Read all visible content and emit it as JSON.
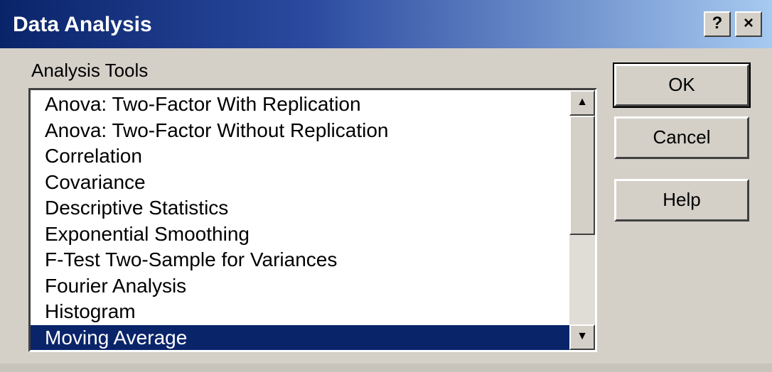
{
  "window": {
    "title": "Data Analysis",
    "help_glyph": "?",
    "close_glyph": "×"
  },
  "analysis_tools_label": "Analysis Tools",
  "list": {
    "items": [
      "Anova: Two-Factor With Replication",
      "Anova: Two-Factor Without Replication",
      "Correlation",
      "Covariance",
      "Descriptive Statistics",
      "Exponential Smoothing",
      "F-Test Two-Sample for Variances",
      "Fourier Analysis",
      "Histogram",
      "Moving Average"
    ],
    "selected_index": 9,
    "scroll_up_glyph": "▲",
    "scroll_down_glyph": "▼"
  },
  "buttons": {
    "ok": "OK",
    "cancel": "Cancel",
    "help": "Help"
  },
  "colors": {
    "selection": "#0a246a",
    "titlebar_start": "#0a246a",
    "titlebar_end": "#a6caf0",
    "face": "#d4d0c8"
  }
}
